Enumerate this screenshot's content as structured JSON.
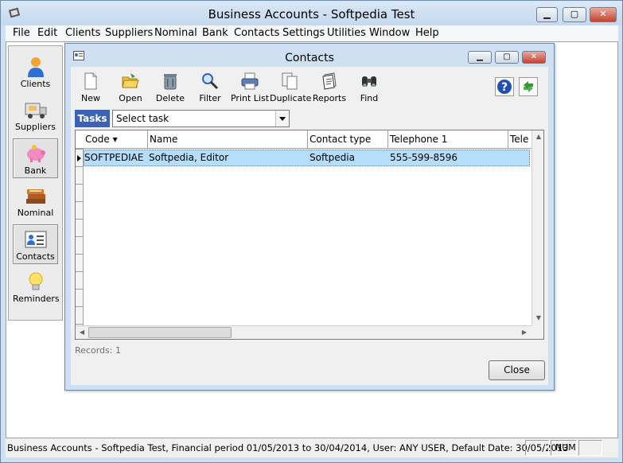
{
  "window": {
    "title": "Business Accounts - Softpedia Test",
    "minimize_glyph": "▁",
    "maximize_glyph": "▢",
    "close_glyph": "✕"
  },
  "menu": [
    "File",
    "Edit",
    "Clients",
    "Suppliers",
    "Nominal",
    "Bank",
    "Contacts",
    "Settings",
    "Utilities",
    "Window",
    "Help"
  ],
  "nav": [
    {
      "label": "Clients",
      "icon": "clients-person-icon",
      "selected": false
    },
    {
      "label": "Suppliers",
      "icon": "supplier-truck-icon",
      "selected": false
    },
    {
      "label": "Bank",
      "icon": "piggy-bank-icon",
      "selected": true
    },
    {
      "label": "Nominal",
      "icon": "books-icon",
      "selected": false
    },
    {
      "label": "Contacts",
      "icon": "contact-card-icon",
      "selected": true
    },
    {
      "label": "Reminders",
      "icon": "lightbulb-icon",
      "selected": false
    }
  ],
  "contacts_window": {
    "title": "Contacts",
    "toolbar": [
      {
        "label": "New",
        "icon": "new-document-icon"
      },
      {
        "label": "Open",
        "icon": "open-folder-icon"
      },
      {
        "label": "Delete",
        "icon": "trash-can-icon"
      },
      {
        "label": "Filter",
        "icon": "magnifier-icon"
      },
      {
        "label": "Print List",
        "icon": "printer-icon"
      },
      {
        "label": "Duplicate",
        "icon": "duplicate-pages-icon"
      },
      {
        "label": "Reports",
        "icon": "reports-icon"
      },
      {
        "label": "Find",
        "icon": "binoculars-icon"
      }
    ],
    "help_icon": "help-question-icon",
    "refresh_icon": "refresh-arrows-icon",
    "tasks_label": "Tasks",
    "tasks_value": "Select task",
    "grid": {
      "columns": [
        "Code",
        "Name",
        "Contact type",
        "Telephone 1",
        "Tele"
      ],
      "sorted_indicator": "▾",
      "rows": [
        {
          "code": "SOFTPEDIAE",
          "name": "Softpedia, Editor",
          "type": "Softpedia",
          "phone": "555-599-8596"
        }
      ]
    },
    "records_text": "Records: 1",
    "close_label": "Close"
  },
  "status": {
    "text": "Business Accounts - Softpedia Test, Financial period 01/05/2013 to 30/04/2014, User: ANY USER, Default Date: 30/05/2013",
    "num": "NUM"
  },
  "colors": {
    "accent": "#3a62b7",
    "selected_row": "#b6ddfa",
    "frame": "#cfe0f2"
  }
}
